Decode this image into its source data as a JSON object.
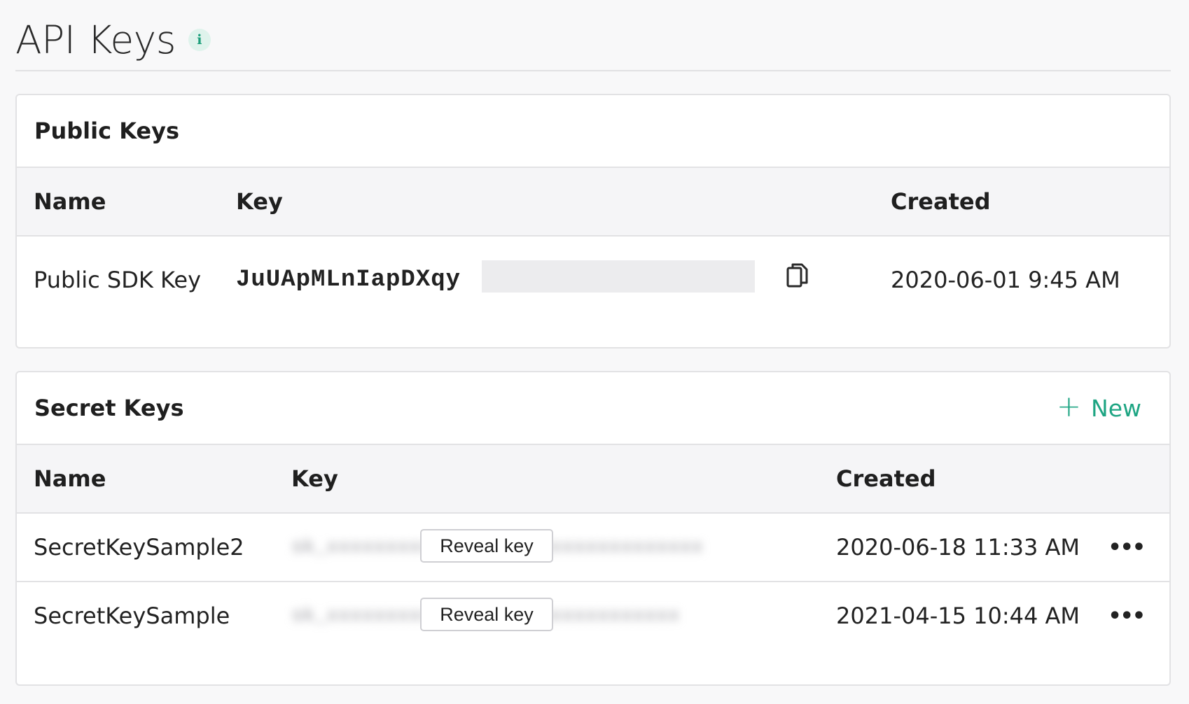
{
  "page": {
    "title": "API Keys",
    "info_icon": "info-icon"
  },
  "public_keys": {
    "title": "Public Keys",
    "columns": [
      "Name",
      "Key",
      "Created"
    ],
    "rows": [
      {
        "name": "Public SDK Key",
        "key": "JuUApMLnIapDXqy",
        "created": "2020-06-01 9:45 AM"
      }
    ]
  },
  "secret_keys": {
    "title": "Secret Keys",
    "new_label": "New",
    "columns": [
      "Name",
      "Key",
      "Created"
    ],
    "reveal_label": "Reveal key",
    "rows": [
      {
        "name": "SecretKeySample2",
        "created": "2020-06-18 11:33 AM"
      },
      {
        "name": "SecretKeySample",
        "created": "2021-04-15 10:44 AM"
      }
    ]
  },
  "colors": {
    "accent": "#1ea583",
    "border": "#e2e2e4",
    "header_bg": "#f5f5f7"
  }
}
